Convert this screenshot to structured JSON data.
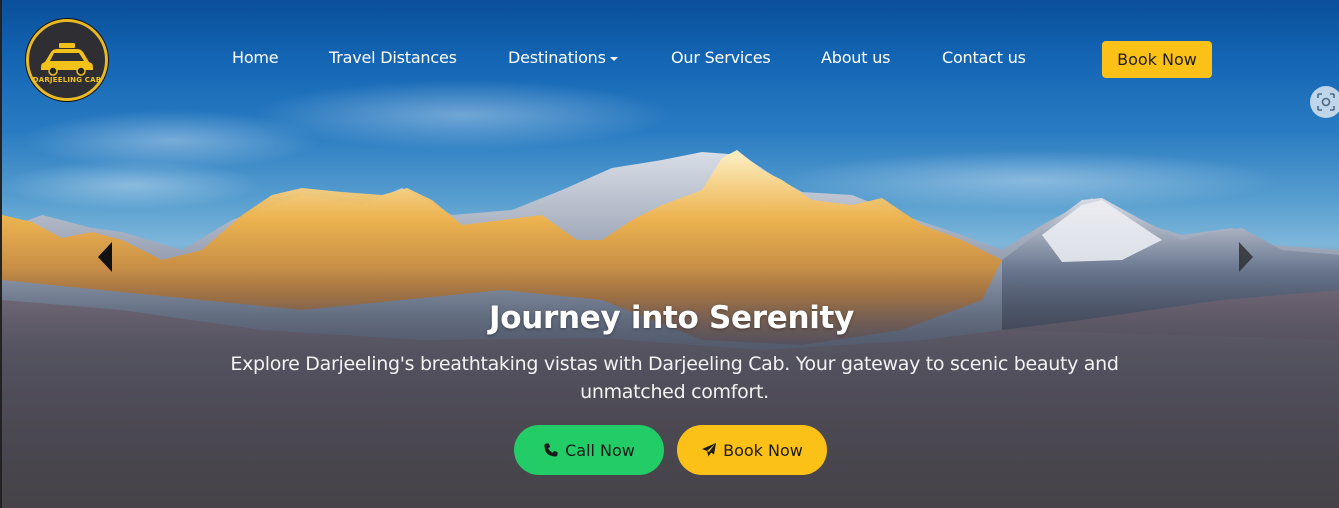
{
  "brand": {
    "logo_text": "DARJEELING CAB",
    "accent_color": "#fcc116"
  },
  "nav": {
    "items": [
      {
        "label": "Home"
      },
      {
        "label": "Travel Distances"
      },
      {
        "label": "Destinations",
        "has_dropdown": true
      },
      {
        "label": "Our Services"
      },
      {
        "label": "About us"
      },
      {
        "label": "Contact us"
      }
    ],
    "cta_label": "Book Now"
  },
  "hero": {
    "title": "Journey into Serenity",
    "subtitle": "Explore Darjeeling's breathtaking vistas with Darjeeling Cab. Your gateway to scenic beauty and unmatched comfort.",
    "call_label": "Call Now",
    "book_label": "Book Now",
    "call_color": "#22cc66",
    "book_color": "#fcc116"
  },
  "icons": {
    "phone": "phone-icon",
    "send": "paper-plane-icon",
    "scan": "scan-icon",
    "prev": "carousel-prev-icon",
    "next": "carousel-next-icon"
  }
}
